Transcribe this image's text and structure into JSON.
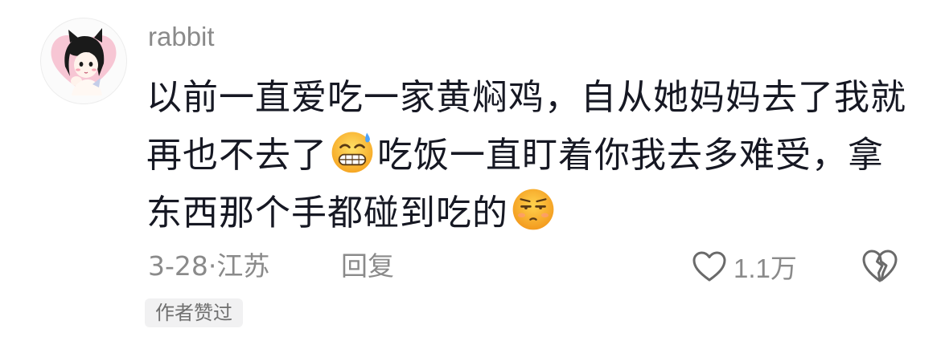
{
  "comment": {
    "username": "rabbit",
    "avatar_icon": "anime-girl-avatar-icon",
    "content_lines": [
      {
        "text_before": "以前一直爱吃一家黄焖鸡，自从她妈妈去了我就",
        "emoji": null,
        "text_after": ""
      },
      {
        "text_before": "再也不去了",
        "emoji": "grin-sweat-emoji-icon",
        "text_after": "吃饭一直盯着你我去多难受，拿"
      },
      {
        "text_before": "东西那个手都碰到吃的",
        "emoji": "unamused-face-emoji-icon",
        "text_after": ""
      }
    ],
    "date": "3-28",
    "separator": "·",
    "location": "江苏",
    "reply_label": "回复",
    "like_count": "1.1万",
    "author_liked_badge": "作者赞过"
  },
  "colors": {
    "text_primary": "#161823",
    "text_secondary": "#8a8a8a",
    "badge_bg": "#f1f1f2",
    "emoji_yellow": "#fbc02d",
    "emoji_orange": "#f59e0b"
  }
}
